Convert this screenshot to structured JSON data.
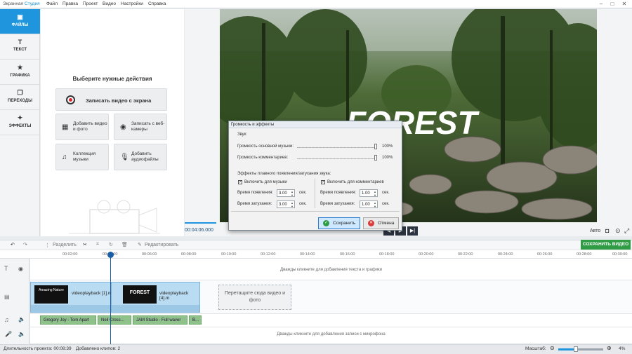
{
  "app": {
    "title_part1": "Экранная ",
    "title_part2": "Студия"
  },
  "menu": [
    "Файл",
    "Правка",
    "Проект",
    "Видео",
    "Настройки",
    "Справка"
  ],
  "left_tabs": [
    {
      "label": "ФАЙЛЫ",
      "icon": "folder-icon"
    },
    {
      "label": "ТЕКСТ",
      "icon": "text-icon"
    },
    {
      "label": "ГРАФИКА",
      "icon": "star-icon"
    },
    {
      "label": "ПЕРЕХОДЫ",
      "icon": "transitions-icon"
    },
    {
      "label": "ЭФФЕКТЫ",
      "icon": "magic-wand-icon"
    }
  ],
  "files_panel": {
    "title": "Выберите нужные действия",
    "record_screen": "Записать видео с экрана",
    "add_video": "Добавить видео и фото",
    "record_webcam": "Записать с веб-камеры",
    "music_collection": "Коллекция музыки",
    "add_audio": "Добавить аудиофайлы"
  },
  "preview": {
    "overlay_text": "FOREST",
    "timecode": "00:04:06.000",
    "aspect": "Авто"
  },
  "toolbar": {
    "split": "Разделить",
    "edit": "Редактировать",
    "save_video": "СОХРАНИТЬ ВИДЕО"
  },
  "ruler_ticks": [
    "00:02:00",
    "00:04:00",
    "00:06:00",
    "00:08:00",
    "00:10:00",
    "00:12:00",
    "00:14:00",
    "00:16:00",
    "00:18:00",
    "00:20:00",
    "00:22:00",
    "00:24:00",
    "00:26:00",
    "00:28:00",
    "00:30:00"
  ],
  "timeline": {
    "text_hint": "Дважды кликните для добавления текста и графики",
    "clip1": "videoplayback [1].mp4",
    "clip1_thumb": "Amazing Nature",
    "clip2_thumb": "FOREST",
    "clip2": "videoplayback [4].m",
    "drop_zone": "Перетащите сюда видео и фото",
    "audio_clips": [
      "Gregory Joy - Tom Apart",
      "Neil Cross...",
      "JAM Studio - Full waver",
      "B..."
    ],
    "mic_hint": "Дважды кликните для добавления записи с микрофона"
  },
  "status": {
    "duration": "Длительность проекта: 00:08:39",
    "clips": "Добавлено клипов: 2",
    "zoom_label": "Масштаб:",
    "zoom_value": "4%",
    "zoom_level": 0.38
  },
  "dialog": {
    "title": "Громкость и эффекты",
    "sound_label": "Звук:",
    "main_music": "Громкость основной музыки:",
    "main_music_value": "100%",
    "comments": "Громкость комментариев:",
    "comments_value": "100%",
    "fade_label": "Эффекты плавного появления/затухания звука:",
    "enable_music": "Включить для музыки",
    "enable_comments": "Включить для комментариев",
    "fade_in": "Время появления:",
    "fade_out": "Время затухания:",
    "music_fade_in": "3.00",
    "music_fade_out": "3.00",
    "comment_fade_in": "1.00",
    "comment_fade_out": "1.00",
    "sec": "сек.",
    "save": "Сохранить",
    "cancel": "Отмена"
  },
  "colors": {
    "accent": "#1f95de",
    "save_green": "#2f9c45",
    "audio_green": "#8fc18b"
  }
}
